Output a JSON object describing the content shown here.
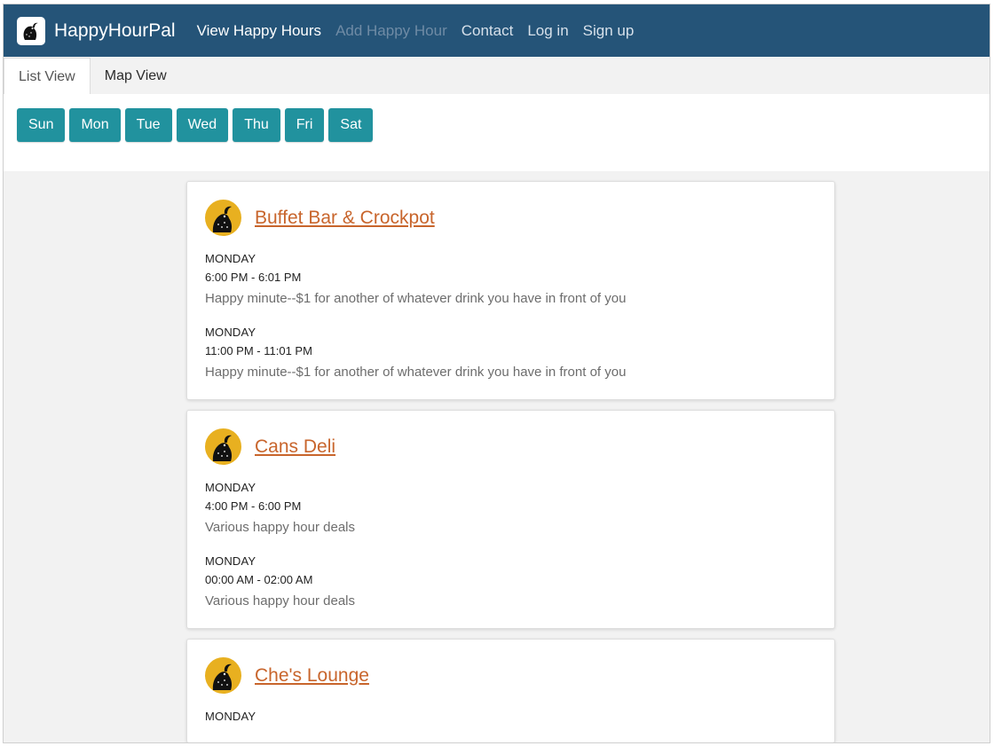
{
  "nav": {
    "brand": "HappyHourPal",
    "links": [
      "View Happy Hours",
      "Add Happy Hour",
      "Contact",
      "Log in",
      "Sign up"
    ]
  },
  "tabs": [
    "List View",
    "Map View"
  ],
  "days": [
    "Sun",
    "Mon",
    "Tue",
    "Wed",
    "Thu",
    "Fri",
    "Sat"
  ],
  "venues": [
    {
      "name": "Buffet Bar & Crockpot",
      "deals": [
        {
          "day": "MONDAY",
          "time": "6:00 PM - 6:01 PM",
          "desc": "Happy minute--$1 for another of whatever drink you have in front of you"
        },
        {
          "day": "MONDAY",
          "time": "11:00 PM - 11:01 PM",
          "desc": "Happy minute--$1 for another of whatever drink you have in front of you"
        }
      ]
    },
    {
      "name": "Cans Deli",
      "deals": [
        {
          "day": "MONDAY",
          "time": "4:00 PM - 6:00 PM",
          "desc": "Various happy hour deals"
        },
        {
          "day": "MONDAY",
          "time": "00:00 AM - 02:00 AM",
          "desc": "Various happy hour deals"
        }
      ]
    },
    {
      "name": "Che's Lounge",
      "deals": [
        {
          "day": "MONDAY",
          "time": "",
          "desc": ""
        }
      ]
    }
  ],
  "colors": {
    "navbar": "#255478",
    "day_button": "#21929e",
    "venue_link": "#c8652c",
    "icon_bg": "#e8b020"
  }
}
